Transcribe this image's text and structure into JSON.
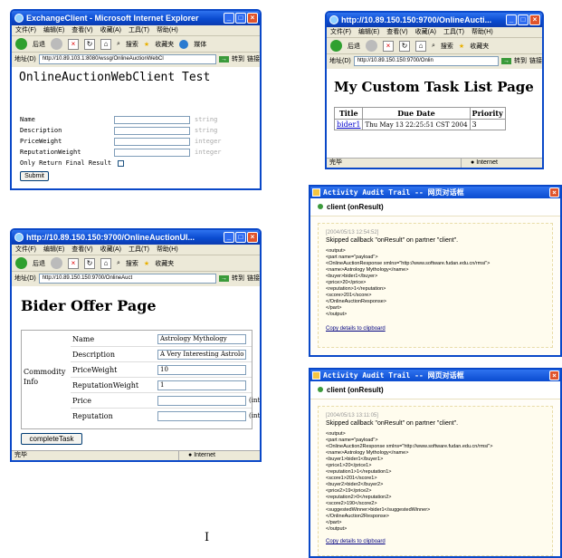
{
  "menus": {
    "cn": [
      "文件(F)",
      "编辑(E)",
      "查看(V)",
      "收藏(A)",
      "工具(T)",
      "帮助(H)"
    ]
  },
  "toolbar": {
    "back": "后退",
    "search": "搜索",
    "fav": "收藏夹",
    "media": "媒体"
  },
  "address": {
    "label": "地址(D)",
    "go": "转到",
    "links": "链接"
  },
  "w1": {
    "title": "ExchangeClient - Microsoft Internet Explorer",
    "url": "http://10.89.103.1:8080/wssg/OnlineAuctionWebCl",
    "heading": "OnlineAuctionWebClient Test",
    "fields": [
      {
        "label": "Name",
        "type": "string"
      },
      {
        "label": "Description",
        "type": "string"
      },
      {
        "label": "PriceWeight",
        "type": "integer"
      },
      {
        "label": "ReputationWeight",
        "type": "integer"
      }
    ],
    "final_label": "Only Return Final Result",
    "submit": "Submit"
  },
  "w2": {
    "title": "http://10.89.150.150:9700/OnlineAucti...",
    "url": "http://10.89.150.150:9700/Onlin",
    "heading": "My Custom Task List Page",
    "cols": [
      "Title",
      "Due Date",
      "Priority"
    ],
    "row": {
      "title": "bider1",
      "date": "Thu May 13 22:25:51 CST 2004",
      "priority": "3"
    },
    "status": "完毕",
    "zone": "Internet"
  },
  "w3": {
    "title": "http://10.89.150.150:9700/OnlineAuctionUI...",
    "url": "http://10.89.150.150:9700/OnlineAuct",
    "heading": "Bider Offer Page",
    "group": "Commodity Info",
    "rows": [
      {
        "label": "Name",
        "value": "Astrology Mythology",
        "unit": ""
      },
      {
        "label": "Description",
        "value": "A Very Interesting Astrolo",
        "unit": ""
      },
      {
        "label": "PriceWeight",
        "value": "10",
        "unit": ""
      },
      {
        "label": "ReputationWeight",
        "value": "1",
        "unit": ""
      },
      {
        "label": "Price",
        "value": "",
        "unit": "(int)"
      },
      {
        "label": "Reputation",
        "value": "",
        "unit": "(int)"
      }
    ],
    "complete": "completeTask",
    "status": "完毕",
    "zone": "Internet"
  },
  "d1": {
    "title": "Activity Audit Trail -- 网页对话框",
    "head": "client (onResult)",
    "ts": "[2004/05/13 12:54:52]",
    "msg": "Skipped callback \"onResult\" on partner \"client\".",
    "xml": "<output>\n<part name=\"payload\">\n<OnlineAuctionResponse xmlns=\"http://www.software.fudan.edu.cn/rmsi\">\n<name>Astrology Mythology</name>\n<buyer>bider1</buyer>\n<price>20</price>\n<reputation>1</reputation>\n<score>201</score>\n</OnlineAuctionResponse>\n</part>\n</output>",
    "copy": "Copy details to clipboard"
  },
  "d2": {
    "title": "Activity Audit Trail -- 网页对话框",
    "head": "client (onResult)",
    "ts": "[2004/05/13 13:11:05]",
    "msg": "Skipped callback \"onResult\" on partner \"client\".",
    "xml": "<output>\n<part name=\"payload\">\n<OnlineAuction2Response xmlns=\"http://www.software.fudan.edu.cn/rmsi\">\n<name>Astrology Mythology</name>\n<buyer1>bider1</buyer1>\n<price1>20</price1>\n<reputation1>1</reputation1>\n<score1>201</score1>\n<buyer2>bider2</buyer2>\n<price2>19</price2>\n<reputation2>0</reputation2>\n<score2>190</score2>\n<suggestedWinner>bider1</suggestedWinner>\n</OnlineAuction2Response>\n</part>\n</output>",
    "copy": "Copy details to clipboard"
  },
  "cursor": "I"
}
